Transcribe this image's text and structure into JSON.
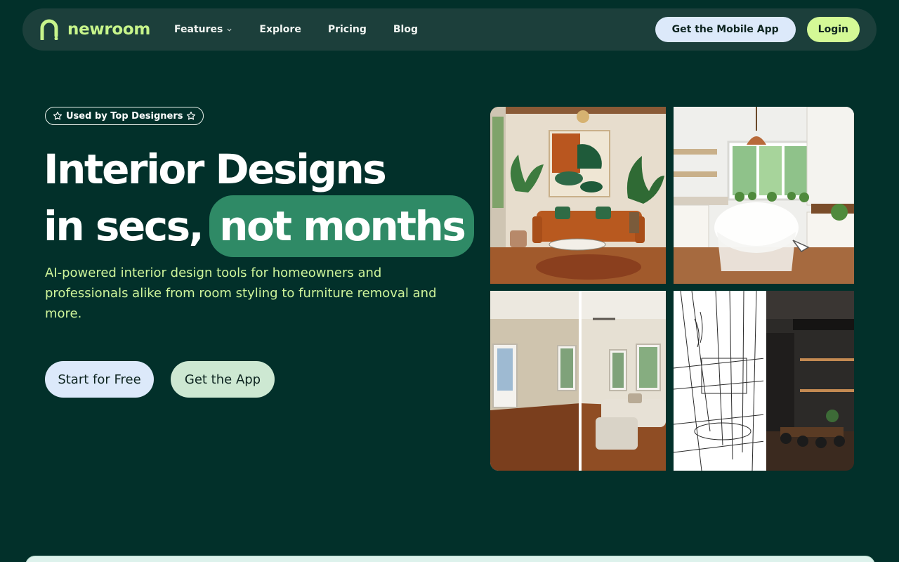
{
  "nav": {
    "logo_text": "newroom",
    "links": [
      {
        "label": "Features",
        "has_dropdown": true
      },
      {
        "label": "Explore"
      },
      {
        "label": "Pricing"
      },
      {
        "label": "Blog"
      }
    ],
    "mobile_app_button": "Get the Mobile App",
    "login_button": "Login"
  },
  "hero": {
    "badge": "Used by Top Designers",
    "headline_line1": "Interior Designs",
    "headline_line2_prefix": "in secs,",
    "headline_highlight": "not months",
    "subtext": "AI-powered interior design tools for homeowners and professionals alike from room styling to furniture removal and more.",
    "cta_primary": "Start for Free",
    "cta_secondary": "Get the App"
  },
  "gallery": {
    "tiles": [
      {
        "name": "living-room-render"
      },
      {
        "name": "kitchen-render"
      },
      {
        "name": "empty-vs-furnished-room"
      },
      {
        "name": "sketch-vs-render-dining"
      }
    ]
  },
  "colors": {
    "background": "#02302a",
    "navbar": "#1c3f3b",
    "accent_lime": "#d4f996",
    "accent_green": "#2f8a66",
    "subtext": "#cff59b",
    "button_blue": "#dce9fa"
  }
}
